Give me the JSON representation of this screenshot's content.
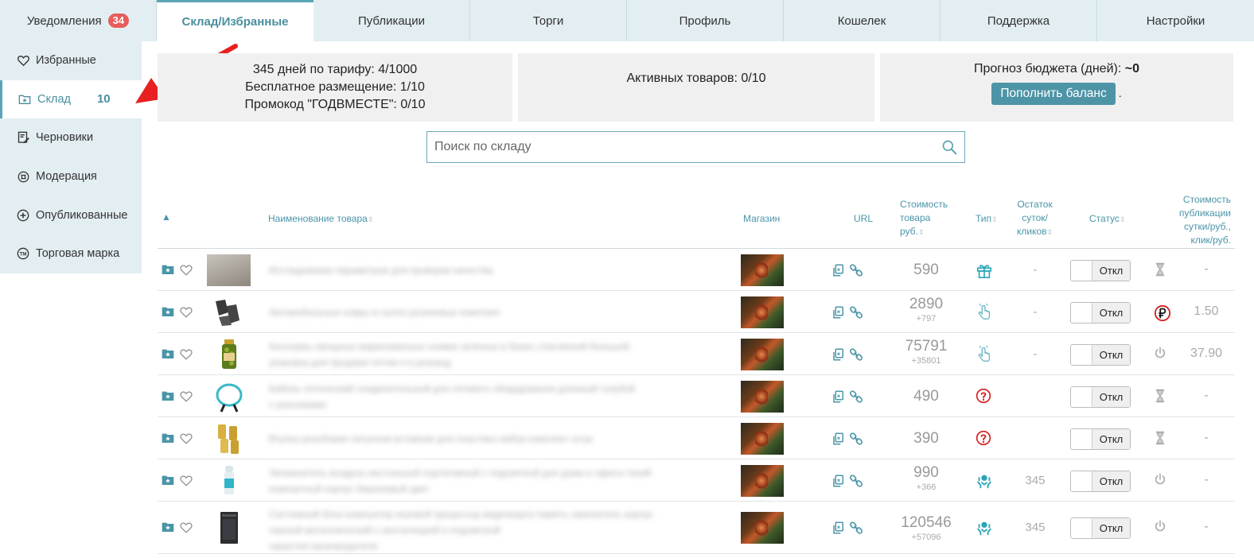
{
  "tabs": [
    {
      "label": "Уведомления",
      "badge": "34"
    },
    {
      "label": "Склад/Избранные"
    },
    {
      "label": "Публикации"
    },
    {
      "label": "Торги"
    },
    {
      "label": "Профиль"
    },
    {
      "label": "Кошелек"
    },
    {
      "label": "Поддержка"
    },
    {
      "label": "Настройки"
    }
  ],
  "sidebar": {
    "items": [
      {
        "label": "Избранные",
        "icon": "heart-icon"
      },
      {
        "label": "Склад",
        "icon": "folder-star-icon",
        "count": "10"
      },
      {
        "label": "Черновики",
        "icon": "draft-icon"
      },
      {
        "label": "Модерация",
        "icon": "moderation-icon"
      },
      {
        "label": "Опубликованные",
        "icon": "plus-circle-icon"
      },
      {
        "label": "Торговая марка",
        "icon": "trademark-icon"
      }
    ]
  },
  "info": {
    "tariff": "345 дней по тарифу: 4/1000",
    "free": "Бесплатное размещение: 1/10",
    "promo": "Промокод \"ГОДВМЕСТЕ\": 0/10",
    "active": "Активных товаров: 0/10",
    "budget_label": "Прогноз бюджета (дней): ",
    "budget_value": "~0",
    "topup": "Пополнить баланс",
    "dot": "."
  },
  "search": {
    "placeholder": "Поиск по складу"
  },
  "table": {
    "headers": {
      "sort": "▲",
      "name": "Наименование товара",
      "shop": "Магазин",
      "url": "URL",
      "cost": [
        "Стоимость",
        "товара",
        "руб."
      ],
      "type": "Тип",
      "remain": [
        "Остаток",
        "суток/",
        "кликов"
      ],
      "status": "Статус",
      "pubcost": [
        "Стоимость",
        "публикации",
        "сутки/руб.,",
        "клик/руб."
      ]
    },
    "rows": [
      {
        "price": "590",
        "sub": "",
        "type": "gift",
        "remain": "-",
        "toggle": "Откл",
        "status": "hourglass",
        "pub": "-",
        "lines": [
          "Исследование параметров для проверки качества"
        ]
      },
      {
        "price": "2890",
        "sub": "+797",
        "type": "click",
        "remain": "-",
        "toggle": "Откл",
        "status": "ruble-stop",
        "pub": "1.50",
        "lines": [
          "Автомобильные ковры в салон резиновые комплект"
        ]
      },
      {
        "price": "75791",
        "sub": "+35801",
        "type": "click",
        "remain": "-",
        "toggle": "Откл",
        "status": "power",
        "pub": "37.90",
        "lines": [
          "Консервы овощные маринованные оливки зеленые в банке стеклянной большой",
          "упаковка для продажи оптом и в розницу"
        ]
      },
      {
        "price": "490",
        "sub": "",
        "type": "question",
        "remain": "",
        "toggle": "Откл",
        "status": "hourglass",
        "pub": "-",
        "lines": [
          "Кабель оптический соединительный для сетевого оборудования длинный голубой",
          "с разъемами"
        ]
      },
      {
        "price": "390",
        "sub": "",
        "type": "question",
        "remain": "",
        "toggle": "Откл",
        "status": "hourglass",
        "pub": "-",
        "lines": [
          "Втулка резьбовая латунная вставная для пластика набор комплект штук"
        ]
      },
      {
        "price": "990",
        "sub": "+366",
        "type": "hands",
        "remain": "345",
        "toggle": "Откл",
        "status": "power",
        "pub": "-",
        "lines": [
          "Увлажнитель воздуха настольный портативный с подсветкой для дома и офиса тихий",
          "компактный корпус бирюзовый цвет"
        ]
      },
      {
        "price": "120546",
        "sub": "+57096",
        "type": "hands",
        "remain": "345",
        "toggle": "Откл",
        "status": "power",
        "pub": "-",
        "lines": [
          "Системный блок компьютер игровой процессор видеокарта память накопитель корпус",
          "черный металлический с вентиляцией и подсветкой",
          "гарантия производителя"
        ]
      }
    ]
  },
  "colors": {
    "accent": "#4a95a8",
    "badge": "#e85c5c",
    "arrow": "#e82020"
  }
}
